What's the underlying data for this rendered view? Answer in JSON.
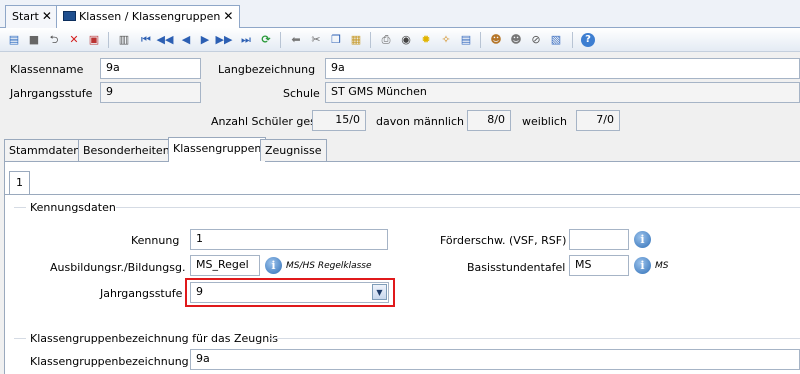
{
  "tabs": {
    "start": "Start",
    "klassen": "Klassen / Klassengruppen"
  },
  "header": {
    "klassenname_label": "Klassenname",
    "klassenname_value": "9a",
    "langbezeichnung_label": "Langbezeichnung",
    "langbezeichnung_value": "9a",
    "jahrgangsstufe_label": "Jahrgangsstufe",
    "jahrgangsstufe_value": "9",
    "schule_label": "Schule",
    "schule_value": "ST GMS München",
    "anzahl_label": "Anzahl Schüler ges.",
    "anzahl_value": "15/0",
    "maennlich_label": "davon männlich",
    "maennlich_value": "8/0",
    "weiblich_label": "weiblich",
    "weiblich_value": "7/0"
  },
  "inner_tabs": [
    "Stammdaten",
    "Besonderheiten",
    "Klassengruppen",
    "Zeugnisse"
  ],
  "group_tab": "1",
  "kennung_section": {
    "title": "Kennungsdaten",
    "kennung_label": "Kennung",
    "kennung_value": "1",
    "ausbildung_label": "Ausbildungsr./Bildungsg.",
    "ausbildung_value": "MS_Regel",
    "ausbildung_desc": "MS/HS Regelklasse",
    "jahrgangsstufe_label": "Jahrgangsstufe",
    "jahrgangsstufe_value": "9",
    "foerder_label": "Förderschw. (VSF, RSF)",
    "foerder_value": "",
    "basis_label": "Basisstundentafel",
    "basis_value": "MS",
    "basis_desc": "MS"
  },
  "zeugnis_section": {
    "title": "Klassengruppenbezeichnung für das Zeugnis",
    "bezeichnung_label": "Klassengruppenbezeichnung",
    "bezeichnung_value": "9a"
  },
  "highlight_color": "#e0191b",
  "info_glyph": "i"
}
